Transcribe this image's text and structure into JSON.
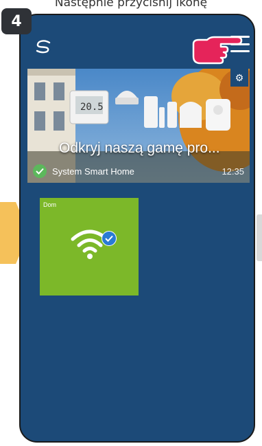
{
  "step": {
    "number": "4"
  },
  "caption": {
    "text": "Następnie przyciśnij ikonę"
  },
  "header": {
    "logo_icon": "salus-logo-icon",
    "menu_icon": "hamburger-menu-icon",
    "pointer_icon": "pointing-hand-icon"
  },
  "banner": {
    "title": "Odkryj naszą gamę pro...",
    "subtitle": "System Smart Home",
    "time": "12:35",
    "thermostat_display": "20.5",
    "settings_icon": "gear-icon",
    "status_icon": "check-circle-icon"
  },
  "tile": {
    "label": "Dom",
    "icon": "wifi-icon",
    "status_icon": "check-badge-icon",
    "color": "#7cb829"
  },
  "colors": {
    "app_background": "#1c4a78",
    "accent_yellow": "#f5c15a",
    "hand_pink": "#e5245a"
  }
}
